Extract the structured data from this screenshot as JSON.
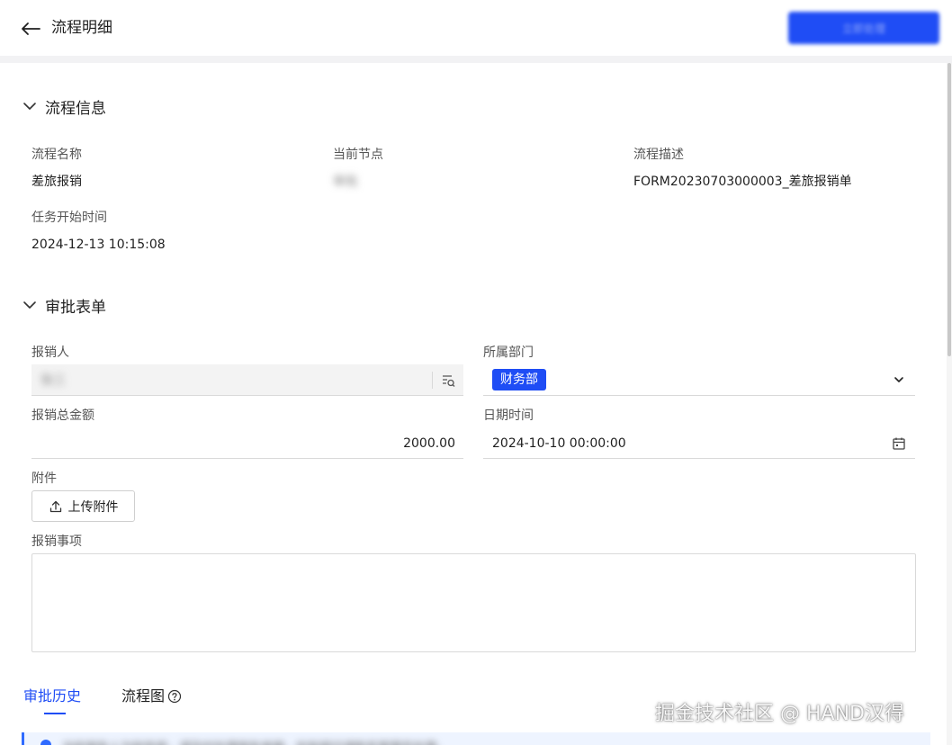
{
  "header": {
    "title": "流程明细",
    "action_label": "立即处理"
  },
  "process_info": {
    "title": "流程信息",
    "fields": [
      {
        "label": "流程名称",
        "value": "差旅报销"
      },
      {
        "label": "当前节点",
        "value": "审批"
      },
      {
        "label": "流程描述",
        "value": "FORM20230703000003_差旅报销单"
      },
      {
        "label": "任务开始时间",
        "value": "2024-12-13 10:15:08"
      }
    ]
  },
  "approval_form": {
    "title": "审批表单",
    "reimburser": {
      "label": "报销人",
      "value": "张三"
    },
    "department": {
      "label": "所属部门",
      "value": "财务部"
    },
    "total_amount": {
      "label": "报销总金额",
      "value": "2000.00"
    },
    "date_time": {
      "label": "日期时间",
      "value": "2024-10-10 00:00:00"
    },
    "attachment": {
      "label": "附件",
      "upload_label": "上传附件"
    },
    "matters": {
      "label": "报销事项",
      "value": ""
    }
  },
  "tabs": [
    {
      "label": "审批历史",
      "active": true
    },
    {
      "label": "流程图",
      "active": false
    }
  ],
  "alert": {
    "text": "当前审批人为财务部，请及时处理审批单据，如有疑问请联系管理员处理。"
  },
  "watermark": "掘金技术社区 @ HAND汉得",
  "colors": {
    "accent": "#1f4df5",
    "border": "#d9d9d9",
    "label": "#555555"
  }
}
